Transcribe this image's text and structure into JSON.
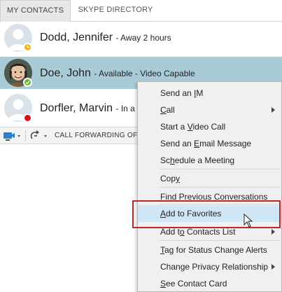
{
  "tabs": {
    "my_contacts": "MY CONTACTS",
    "skype_directory": "SKYPE DIRECTORY"
  },
  "contacts": [
    {
      "name": "Dodd, Jennifer",
      "status": "- Away 2 hours",
      "presence": "away",
      "presence_color": "#f2b51d"
    },
    {
      "name": "Doe, John",
      "status": "- Available - Video Capable",
      "presence": "available",
      "presence_color": "#6bb32e"
    },
    {
      "name": "Dorfler, Marvin",
      "status": "- In a m",
      "presence": "busy",
      "presence_color": "#d0161c"
    }
  ],
  "toolbar": {
    "call_forwarding_label": "CALL FORWARDING OF",
    "video_icon": "video-camera-icon",
    "forward_icon": "call-forward-icon"
  },
  "menu": {
    "send_im": {
      "pre": "Send an ",
      "key": "I",
      "post": "M"
    },
    "call": {
      "pre": "",
      "key": "C",
      "post": "all"
    },
    "start_video": {
      "pre": "Start a ",
      "key": "V",
      "post": "ideo Call"
    },
    "send_email": {
      "pre": "Send an ",
      "key": "E",
      "post": "mail Message"
    },
    "schedule": {
      "pre": "Sc",
      "key": "h",
      "post": "edule a Meeting"
    },
    "copy": {
      "pre": "Cop",
      "key": "y",
      "post": ""
    },
    "find_prev": {
      "pre": "Find Previous Conversations",
      "key": "",
      "post": ""
    },
    "add_favorites": {
      "pre": "",
      "key": "A",
      "post": "dd to Favorites"
    },
    "add_contacts_list": {
      "pre": "Add t",
      "key": "o",
      "post": " Contacts List"
    },
    "tag_status": {
      "pre": "",
      "key": "T",
      "post": "ag for Status Change Alerts"
    },
    "privacy": {
      "pre": "Change Privacy Relationship",
      "key": "",
      "post": ""
    },
    "contact_card": {
      "pre": "",
      "key": "S",
      "post": "ee Contact Card"
    }
  },
  "colors": {
    "selected_row": "#a9cbd8",
    "menu_highlight": "#cfe6f6",
    "callout_border": "#b22a2a"
  }
}
